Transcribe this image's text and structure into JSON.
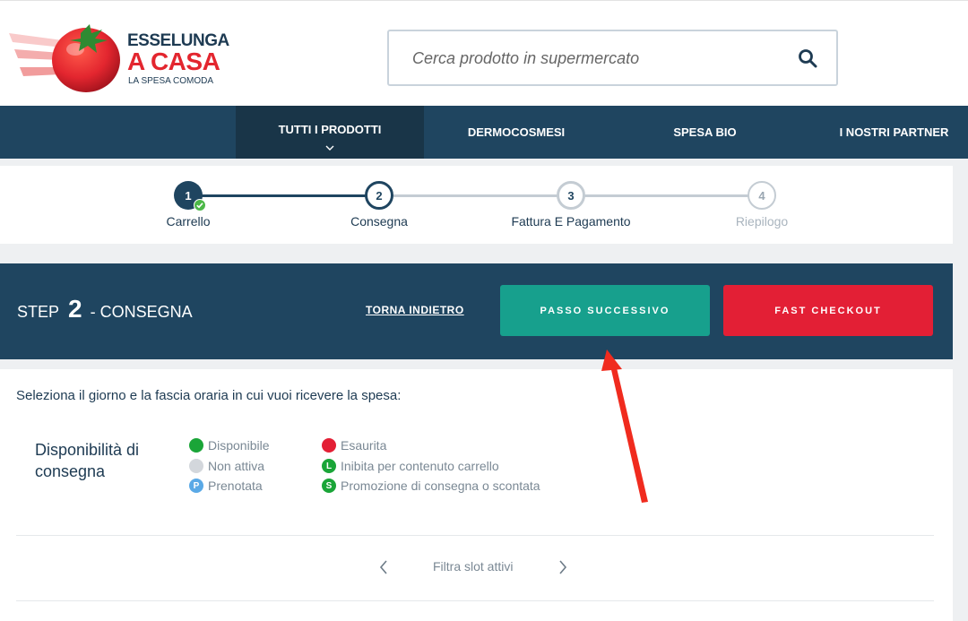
{
  "header": {
    "logo": {
      "line1": "ESSELUNGA",
      "line2": "A CASA",
      "line3": "LA SPESA COMODA"
    },
    "search": {
      "placeholder": "Cerca prodotto in supermercato"
    }
  },
  "nav": {
    "items": [
      {
        "label": "TUTTI I PRODOTTI",
        "active": true
      },
      {
        "label": "DERMOCOSMESI"
      },
      {
        "label": "SPESA BIO"
      },
      {
        "label": "I NOSTRI PARTNER"
      }
    ]
  },
  "steps": [
    {
      "number": "1",
      "label": "Carrello",
      "state": "completed"
    },
    {
      "number": "2",
      "label": "Consegna",
      "state": "current"
    },
    {
      "number": "3",
      "label": "Fattura E Pagamento",
      "state": "upcoming"
    },
    {
      "number": "4",
      "label": "Riepilogo",
      "state": "disabled"
    }
  ],
  "stepbar": {
    "prefix": "STEP",
    "number": "2",
    "suffix": "- CONSEGNA",
    "back_label": "TORNA INDIETRO",
    "next_label": "PASSO SUCCESSIVO",
    "fast_label": "FAST CHECKOUT"
  },
  "content": {
    "instruction": "Seleziona il giorno e la fascia oraria in cui vuoi ricevere la spesa:",
    "legend_title": "Disponibilità di consegna",
    "legend": [
      {
        "label": "Disponibile",
        "color": "#1aa538",
        "glyph": ""
      },
      {
        "label": "Non attiva",
        "color": "#d3d7dc",
        "glyph": ""
      },
      {
        "label": "Prenotata",
        "color": "#5aa9e6",
        "glyph": "P"
      },
      {
        "label": "Esaurita",
        "color": "#e31f35",
        "glyph": ""
      },
      {
        "label": "Inibita per contenuto carrello",
        "color": "#1aa538",
        "glyph": "L"
      },
      {
        "label": "Promozione di consegna o scontata",
        "color": "#1aa538",
        "glyph": "S"
      }
    ],
    "filter_label": "Filtra slot attivi"
  },
  "colors": {
    "navy": "#1f4560",
    "teal": "#17a08d",
    "red": "#e31f35",
    "annotation_arrow": "#f02b1e"
  },
  "icons": {
    "search": "search-icon",
    "chevron_down": "chevron-down-icon",
    "check": "check-icon",
    "prev": "chevron-left-icon",
    "next": "chevron-right-icon"
  }
}
